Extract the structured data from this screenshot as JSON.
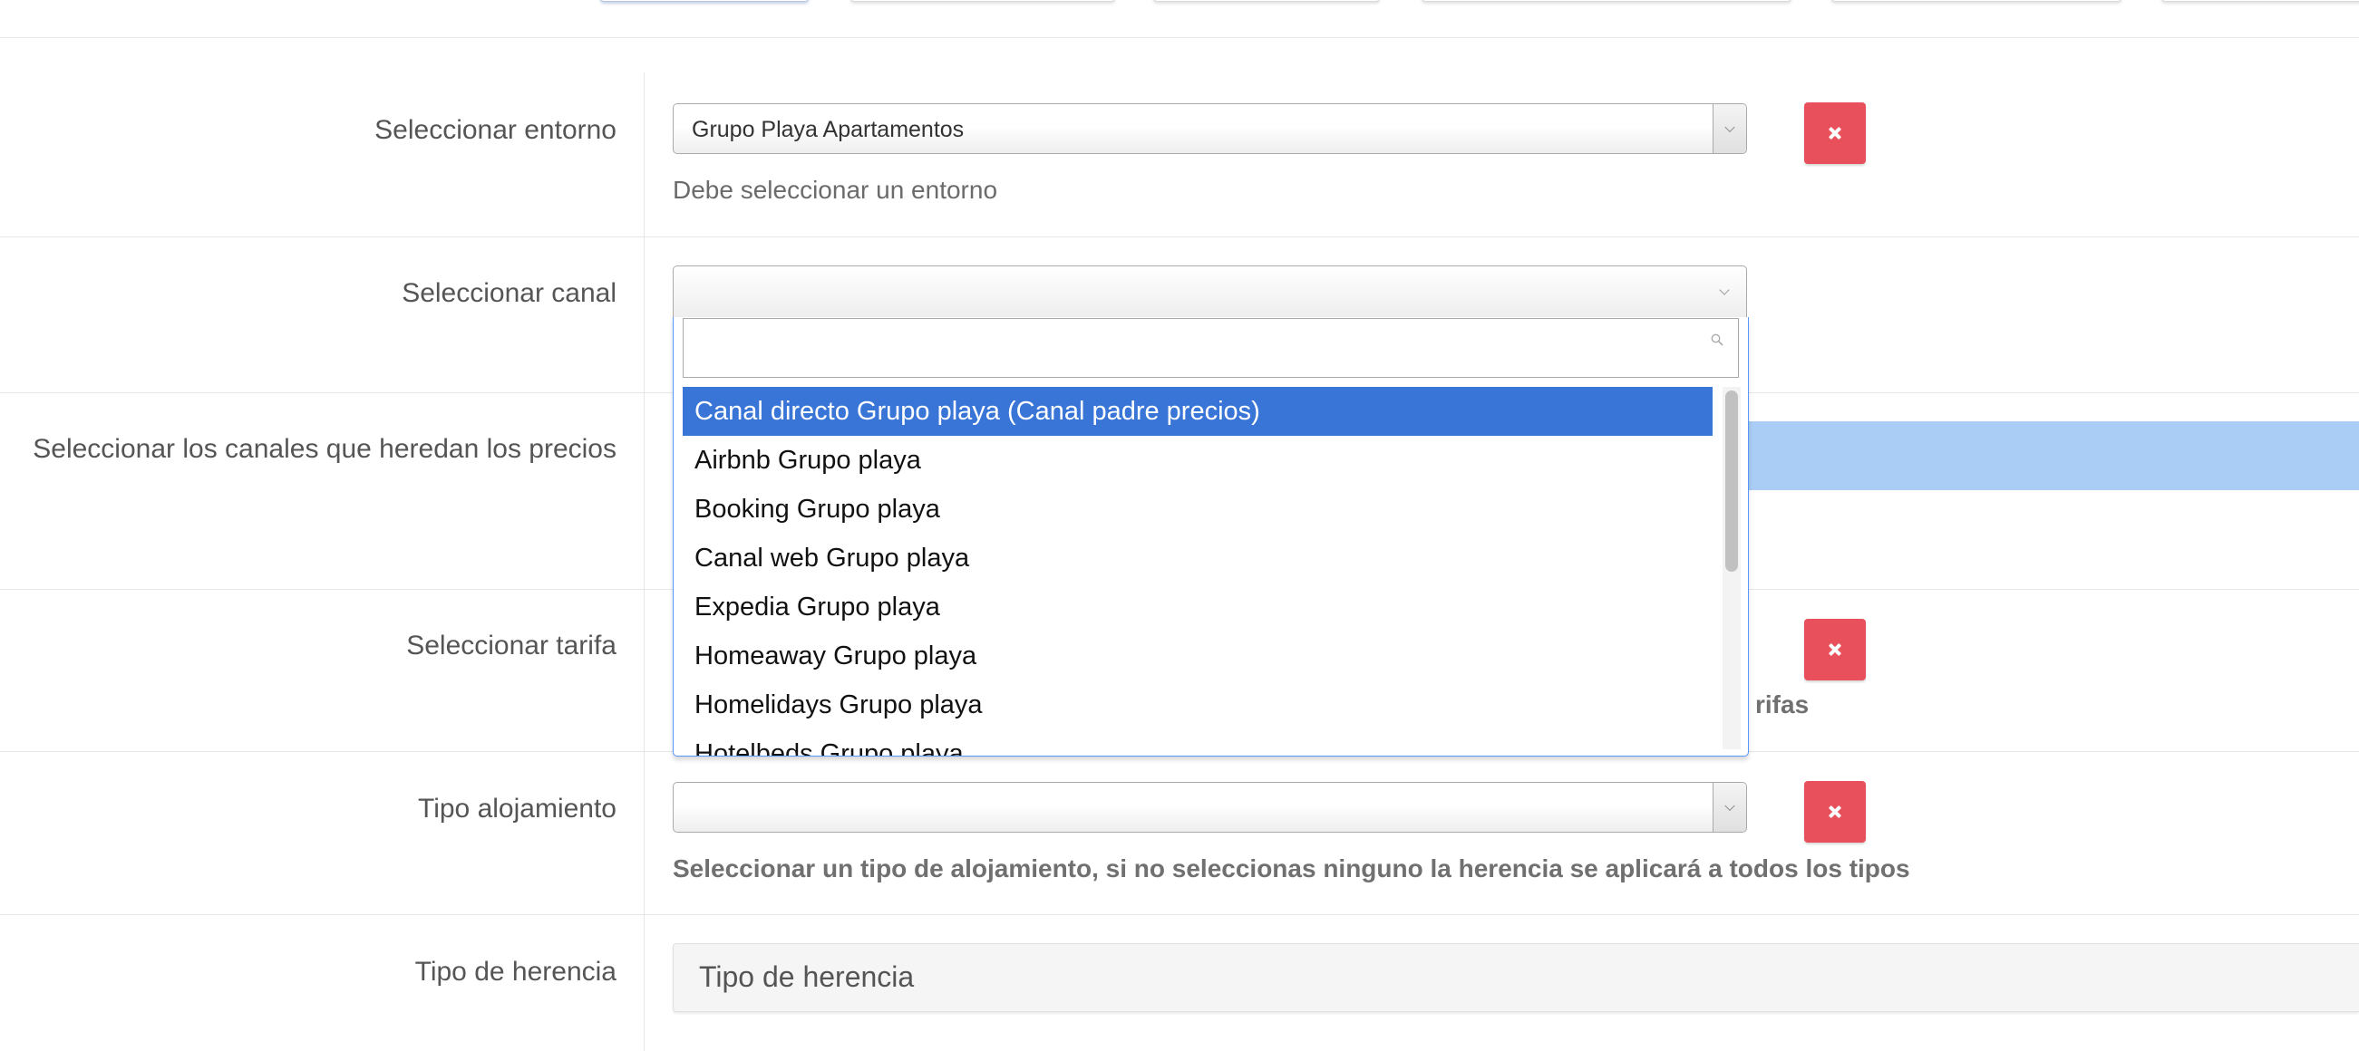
{
  "form": {
    "entorno": {
      "label": "Seleccionar entorno",
      "value": "Grupo Playa Apartamentos",
      "help": "Debe seleccionar un entorno"
    },
    "canal": {
      "label": "Seleccionar canal",
      "value": "",
      "dropdown": {
        "search_value": "",
        "options": [
          "Canal directo Grupo playa (Canal padre precios)",
          "Airbnb Grupo playa",
          "Booking Grupo playa",
          "Canal web Grupo playa",
          "Expedia Grupo playa",
          "Homeaway Grupo playa",
          "Homelidays Grupo playa",
          "Hotelbeds Grupo playa"
        ],
        "highlighted_index": 0
      }
    },
    "heredan": {
      "label": "Seleccionar los canales que heredan los precios"
    },
    "tarifa": {
      "label": "Seleccionar tarifa",
      "help_tail": "rifas"
    },
    "alojamiento": {
      "label": "Tipo alojamiento",
      "value": "",
      "help": "Seleccionar un tipo de alojamiento, si no seleccionas ninguno la herencia se aplicará a todos los tipos"
    },
    "herencia": {
      "label": "Tipo de herencia",
      "value": "Tipo de herencia"
    }
  },
  "icons": {
    "remove": "close-icon",
    "dropdown": "chevron-down-icon",
    "search": "search-icon"
  },
  "colors": {
    "danger": "#e8505b",
    "highlight": "#3875d7",
    "multi_select_bg": "#a9cdf5"
  }
}
